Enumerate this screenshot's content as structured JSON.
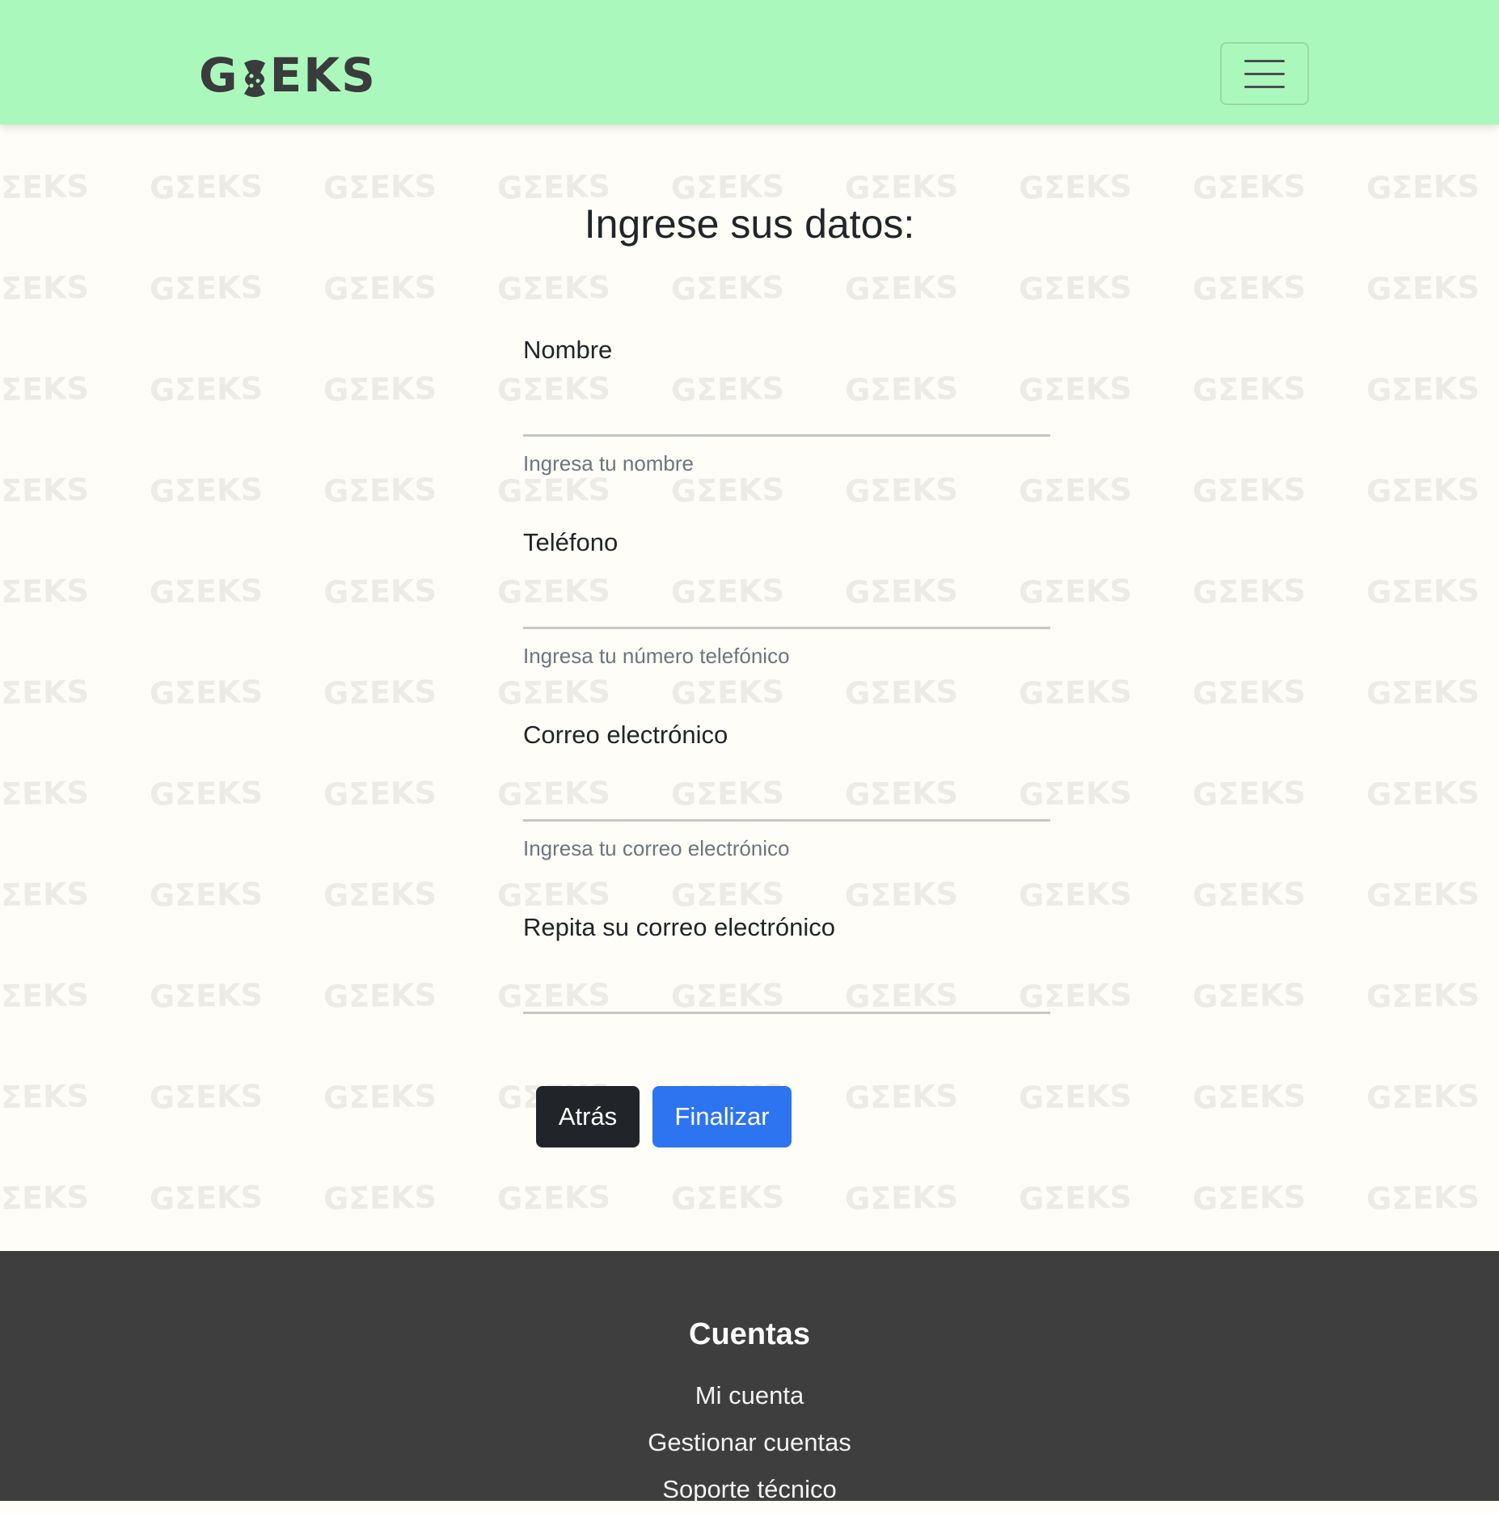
{
  "navbar": {
    "logo_left": "G",
    "logo_right": "EKS",
    "background_color": "#abf8bd",
    "menu_icon": "hamburger-icon"
  },
  "background": {
    "watermark_text": "GΣEKS"
  },
  "form": {
    "title": "Ingrese sus datos:",
    "fields": [
      {
        "label": "Nombre",
        "value": "",
        "help": "Ingresa tu nombre"
      },
      {
        "label": "Teléfono",
        "value": "",
        "help": "Ingresa tu número telefónico"
      },
      {
        "label": "Correo electrónico",
        "value": "",
        "help": "Ingresa tu correo electrónico"
      },
      {
        "label": "Repita su correo electrónico",
        "value": "",
        "help": ""
      }
    ],
    "back_label": "Atrás",
    "finish_label": "Finalizar",
    "primary_color": "#2d74f0",
    "dark_color": "#212529"
  },
  "footer": {
    "heading": "Cuentas",
    "links": [
      "Mi cuenta",
      "Gestionar cuentas",
      "Soporte técnico"
    ],
    "background_color": "#3e3e3e"
  }
}
